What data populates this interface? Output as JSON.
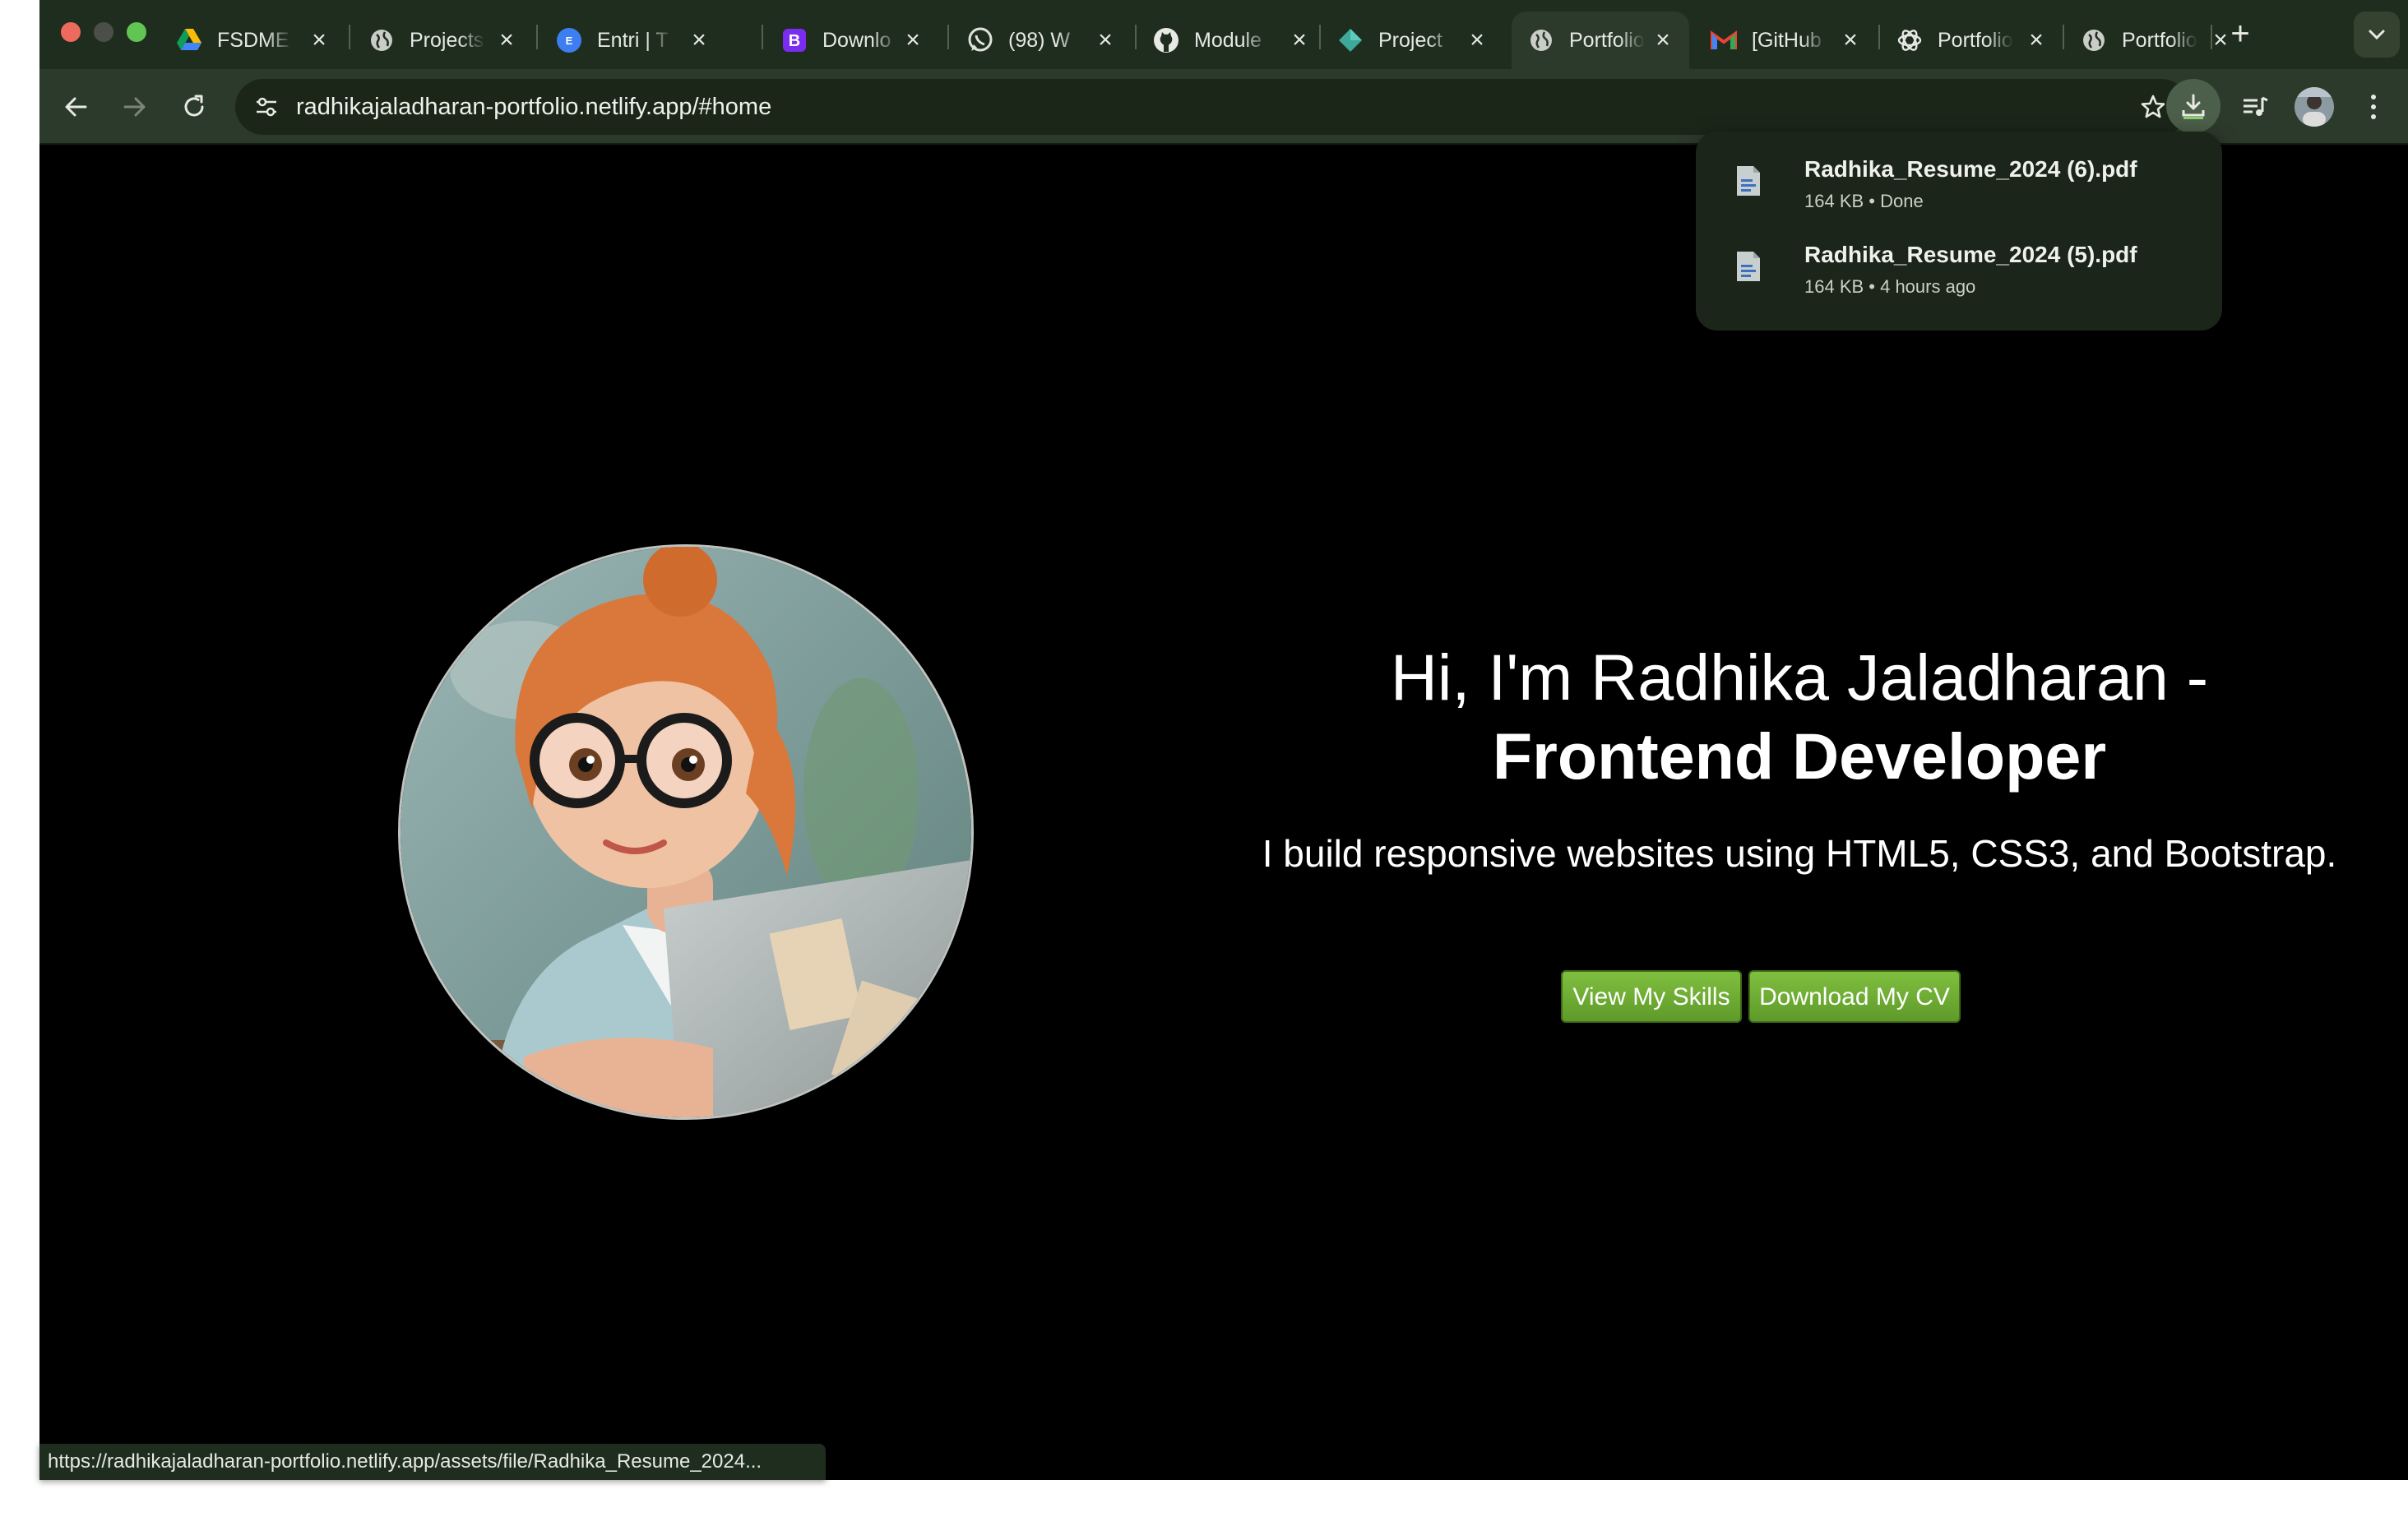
{
  "browser": {
    "tabs": [
      {
        "title": "FSDME",
        "icon": "google-drive-icon"
      },
      {
        "title": "Projects",
        "icon": "globe-icon"
      },
      {
        "title": "Entri | T",
        "icon": "entri-icon"
      },
      {
        "title": "Downlo",
        "icon": "bootstrap-icon"
      },
      {
        "title": "(98) W",
        "icon": "whatsapp-icon"
      },
      {
        "title": "Module",
        "icon": "github-icon"
      },
      {
        "title": "Project",
        "icon": "codepen-diamond-icon"
      },
      {
        "title": "Portfolio",
        "icon": "globe-icon",
        "active": true
      },
      {
        "title": "[GitHub",
        "icon": "gmail-icon"
      },
      {
        "title": "Portfolio",
        "icon": "openai-icon"
      },
      {
        "title": "Portfolio",
        "icon": "globe-icon"
      }
    ],
    "url": "radhikajaladharan-portfolio.netlify.app/#home",
    "colors": {
      "frame": "#1f2d1e",
      "toolbar": "#2c3a2b",
      "omnibox": "#1b2619"
    }
  },
  "downloads": {
    "items": [
      {
        "name": "Radhika_Resume_2024 (6).pdf",
        "meta": "164 KB • Done",
        "icon": "pdf-file-icon"
      },
      {
        "name": "Radhika_Resume_2024 (5).pdf",
        "meta": "164 KB • 4 hours ago",
        "icon": "pdf-file-icon"
      }
    ]
  },
  "page": {
    "heading_line1": "Hi, I'm Radhika Jaladharan -",
    "heading_line2": "Frontend Developer",
    "subheading": "I build responsive websites using HTML5, CSS3, and Bootstrap.",
    "buttons": {
      "skills": "View My Skills",
      "cv": "Download My CV"
    },
    "colors": {
      "background": "#000000",
      "button": "#6aa834"
    }
  },
  "status_bar": {
    "url": "https://radhikajaladharan-portfolio.netlify.app/assets/file/Radhika_Resume_2024..."
  }
}
